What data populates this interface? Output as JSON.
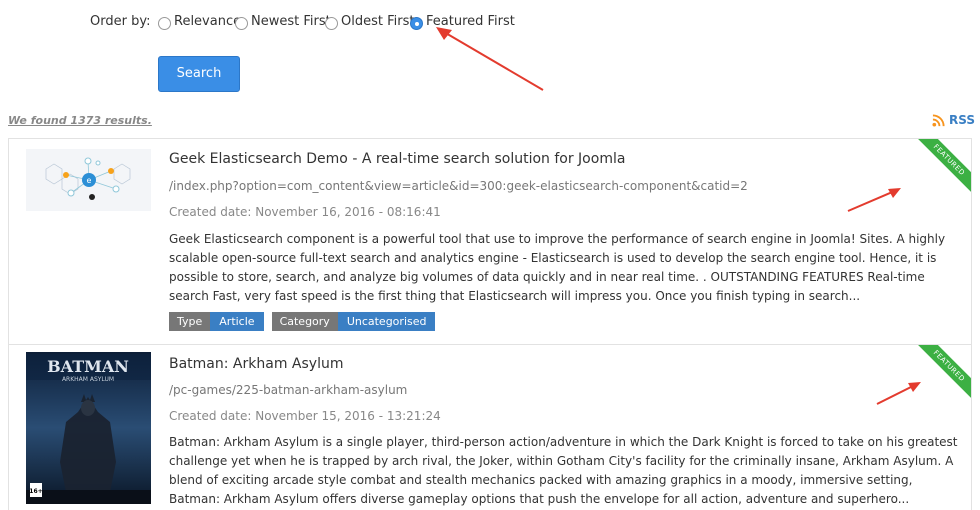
{
  "order": {
    "label": "Order by:",
    "options": [
      {
        "label": "Relevance",
        "checked": false
      },
      {
        "label": "Newest First",
        "checked": false
      },
      {
        "label": "Oldest First",
        "checked": false
      },
      {
        "label": "Featured First",
        "checked": true
      }
    ]
  },
  "search_button": "Search",
  "results_count_text": "We found 1373 results.",
  "rss_label": "RSS",
  "accent_color": "#3a8ee6",
  "featured_color": "#3cb043",
  "annotation_color": "#e33b2e",
  "results": [
    {
      "title": "Geek Elasticsearch Demo - A real-time search solution for Joomla",
      "url": "/index.php?option=com_content&view=article&id=300:geek-elasticsearch-component&catid=2",
      "created": "Created date: November 16, 2016 - 08:16:41",
      "description": "Geek Elasticsearch component is a powerful tool that use to improve the performance of search engine in Joomla! Sites. A highly scalable open-source full-text search and analytics engine - Elasticsearch is used to develop the search engine tool. Hence, it is possible to store, search, and analyze big volumes of data quickly and in near real time. . OUTSTANDING FEATURES Real-time search Fast, very fast speed is the first thing that Elasticsearch will impress you. Once you finish typing in search...",
      "badge": "FEATURED",
      "tags": [
        {
          "key": "Type",
          "value": "Article"
        },
        {
          "key": "Category",
          "value": "Uncategorised"
        }
      ]
    },
    {
      "title": "Batman: Arkham Asylum",
      "url": "/pc-games/225-batman-arkham-asylum",
      "created": "Created date: November 15, 2016 - 13:21:24",
      "description": "Batman: Arkham Asylum is a single player, third-person action/adventure in which the Dark Knight is forced to take on his greatest challenge yet when he is trapped by arch rival, the Joker, within Gotham City's facility for the criminally insane, Arkham Asylum. A blend of exciting arcade style combat and stealth mechanics packed with amazing graphics in a moody, immersive setting, Batman: Arkham Asylum offers diverse gameplay options that push the envelope for all action, adventure and superhero...",
      "badge": "FEATURED",
      "thumb_text": "BATMAN",
      "thumb_subtext": "ARKHAM ASYLUM",
      "rating": "16+"
    }
  ]
}
